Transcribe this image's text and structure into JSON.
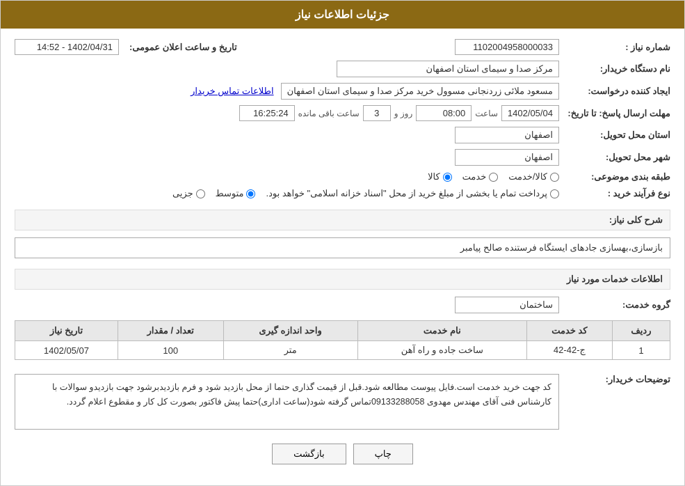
{
  "header": {
    "title": "جزئیات اطلاعات نیاز"
  },
  "fields": {
    "request_number_label": "شماره نیاز :",
    "request_number_value": "1102004958000033",
    "buyer_station_label": "نام دستگاه خریدار:",
    "buyer_station_value": "مرکز صدا و سیمای استان اصفهان",
    "creator_label": "ایجاد کننده درخواست:",
    "creator_value": "مسعود ملائی زردنجانی مسوول خرید مرکز صدا و سیمای استان اصفهان",
    "contact_link": "اطلاعات تماس خریدار",
    "response_deadline_label": "مهلت ارسال پاسخ: تا تاریخ:",
    "response_date": "1402/05/04",
    "response_time_label": "ساعت",
    "response_time": "08:00",
    "response_days_label": "روز و",
    "response_days": "3",
    "response_remaining_label": "ساعت باقی مانده",
    "response_remaining": "16:25:24",
    "delivery_province_label": "استان محل تحویل:",
    "delivery_province_value": "اصفهان",
    "delivery_city_label": "شهر محل تحویل:",
    "delivery_city_value": "اصفهان",
    "subject_label": "طبقه بندی موضوعی:",
    "subject_options": [
      {
        "label": "کالا",
        "value": "kala",
        "selected": true
      },
      {
        "label": "خدمت",
        "value": "khedmat",
        "selected": false
      },
      {
        "label": "کالا/خدمت",
        "value": "kala_khedmat",
        "selected": false
      }
    ],
    "purchase_type_label": "نوع فرآیند خرید :",
    "purchase_type_options": [
      {
        "label": "جزیی",
        "value": "jozi",
        "selected": false
      },
      {
        "label": "متوسط",
        "value": "motvaset",
        "selected": true
      },
      {
        "label": "پرداخت تمام یا بخشی از مبلغ خرید از محل \"اسناد خزانه اسلامی\" خواهد بود.",
        "value": "esnad",
        "selected": false
      }
    ],
    "general_description_label": "شرح کلی نیاز:",
    "general_description_value": "بازسازی،بهسازی جادهای ایستگاه فرستنده صالح پیامبر",
    "services_info_title": "اطلاعات خدمات مورد نیاز",
    "service_group_label": "گروه خدمت:",
    "service_group_value": "ساختمان",
    "table": {
      "headers": [
        "ردیف",
        "کد خدمت",
        "نام خدمت",
        "واحد اندازه گیری",
        "تعداد / مقدار",
        "تاریخ نیاز"
      ],
      "rows": [
        {
          "row": "1",
          "service_code": "ج-42-42",
          "service_name": "ساخت جاده و راه آهن",
          "unit": "متر",
          "quantity": "100",
          "date": "1402/05/07"
        }
      ]
    },
    "buyer_notes_label": "توضیحات خریدار:",
    "buyer_notes_value": "کد جهت خرید خدمت است.فایل پیوست مطالعه شود.قبل از قیمت گذاری حتما از محل بازدید شود و فرم بازدیدبرشود جهت بازدیدو سوالات با کارشناس فنی آقای مهندس مهدوی 09133288058تماس گرفته شود(ساعت اداری)حتما پیش فاکتور بصورت کل کار و مقطوع اعلام گردد.",
    "buttons": {
      "back_label": "بازگشت",
      "print_label": "چاپ"
    },
    "announce_datetime_label": "تاریخ و ساعت اعلان عمومی:",
    "announce_datetime_value": "1402/04/31 - 14:52"
  }
}
